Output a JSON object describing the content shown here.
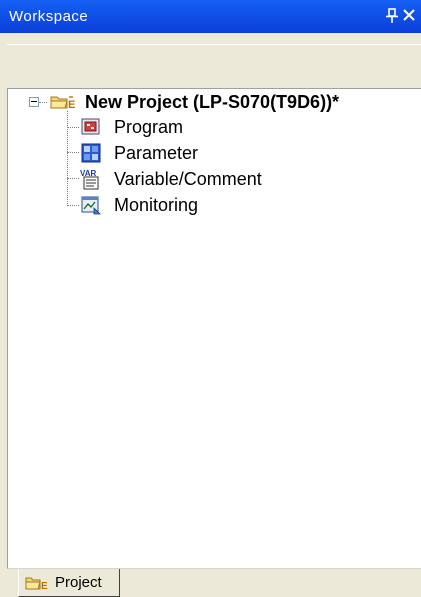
{
  "titlebar": {
    "title": "Workspace",
    "pin_icon": "pin-icon",
    "close_icon": "close-icon",
    "background": "#0a46e6"
  },
  "tree": {
    "root": {
      "label": "New Project (LP-S070(T9D6))*",
      "icon": "project-folder-icon",
      "expanded": true
    },
    "items": [
      {
        "label": "Program",
        "icon": "program-icon"
      },
      {
        "label": "Parameter",
        "icon": "parameter-icon"
      },
      {
        "label": "Variable/Comment",
        "icon": "variable-comment-icon"
      },
      {
        "label": "Monitoring",
        "icon": "monitoring-icon"
      }
    ]
  },
  "tabs": [
    {
      "label": "Project",
      "icon": "project-folder-icon",
      "active": true
    }
  ]
}
